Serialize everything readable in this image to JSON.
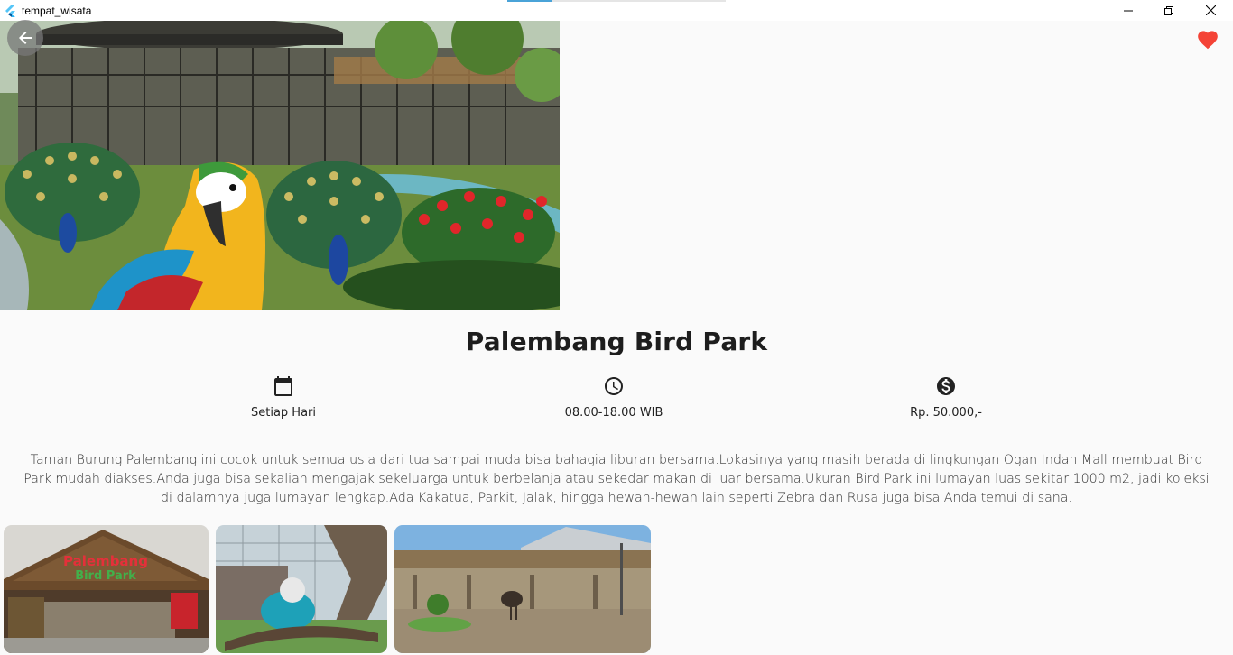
{
  "window": {
    "title": "tempat_wisata",
    "controls": [
      "minimize-icon",
      "restore-icon",
      "close-icon"
    ]
  },
  "hero": {
    "image": "palembang-bird-park-peacocks-macaw-photo",
    "back_icon": "arrow-left-icon",
    "favorite_icon": "heart-icon",
    "favorite_color": "#f44336"
  },
  "place": {
    "name": "Palembang Bird Park"
  },
  "info": [
    {
      "icon": "calendar-icon",
      "label": "Setiap Hari"
    },
    {
      "icon": "clock-icon",
      "label": "08.00-18.00 WIB"
    },
    {
      "icon": "dollar-circle-icon",
      "label": "Rp. 50.000,-"
    }
  ],
  "description": "Taman Burung Palembang ini cocok untuk semua usia dari tua sampai muda bisa bahagia liburan bersama.Lokasinya yang masih berada di lingkungan Ogan Indah Mall membuat Bird Park mudah diakses.Anda juga bisa sekalian mengajak sekeluarga untuk berbelanja atau sekedar makan di luar bersama.Ukuran Bird Park ini lumayan luas sekitar 1000 m2, jadi koleksi di dalamnya juga lumayan lengkap.Ada Kakatua, Parkit, Jalak, hingga hewan-hewan lain seperti Zebra dan Rusa juga bisa Anda temui di sana.",
  "gallery": [
    {
      "image": "entrance-gate-photo",
      "sign_line1": "Palembang",
      "sign_line2": "Bird Park"
    },
    {
      "image": "parakeet-aviary-photo"
    },
    {
      "image": "ostrich-enclosure-photo"
    }
  ],
  "colors": {
    "background": "#fafafa",
    "title_text": "#1d1d1d",
    "favorite": "#f44336"
  }
}
